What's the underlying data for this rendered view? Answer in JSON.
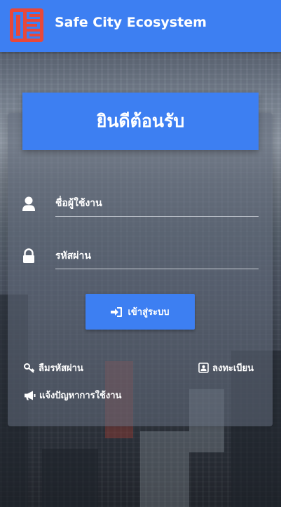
{
  "header": {
    "app_title": "Safe City Ecosystem",
    "logo_icon": "safe-city-logo",
    "bar_color": "#3d7ff2",
    "logo_color": "#e8483a"
  },
  "login": {
    "welcome_title": "ยินดีต้อนรับ",
    "username_placeholder": "ชื่อผู้ใช้งาน",
    "password_placeholder": "รหัสผ่าน",
    "login_label": "เข้าสู่ระบบ"
  },
  "links": {
    "forgot_password": "ลืมรหัสผ่าน",
    "register": "ลงทะเบียน",
    "report_problem": "แจ้งปัญหาการใช้งาน"
  },
  "icons": {
    "username": "user-icon",
    "password": "lock-icon",
    "login": "sign-in-icon",
    "forgot": "key-icon",
    "register": "id-card-icon",
    "report": "megaphone-icon"
  }
}
